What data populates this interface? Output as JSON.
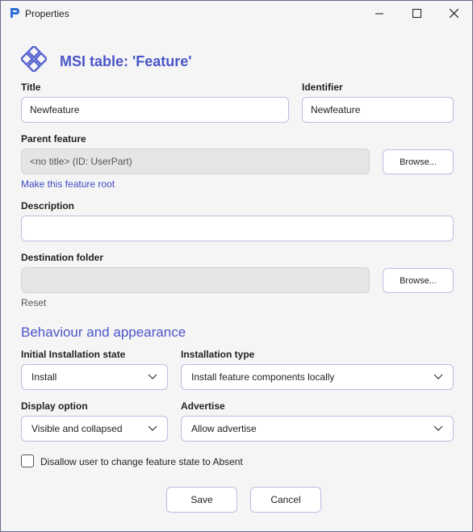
{
  "window": {
    "title": "Properties",
    "icon": "app-logo-icon",
    "controls": [
      "minimize-icon",
      "maximize-icon",
      "close-icon"
    ]
  },
  "header": {
    "icon": "feature-diamond-icon",
    "title": "MSI table: 'Feature'"
  },
  "fields": {
    "title_label": "Title",
    "title_value": "Newfeature",
    "identifier_label": "Identifier",
    "identifier_value": "Newfeature",
    "parent_label": "Parent feature",
    "parent_value": "<no title>  (ID: UserPart)",
    "parent_browse": "Browse...",
    "make_root_link": "Make this feature root",
    "description_label": "Description",
    "description_value": "",
    "destination_label": "Destination folder",
    "destination_value": "",
    "destination_browse": "Browse...",
    "reset_link": "Reset"
  },
  "behaviour": {
    "section_title": "Behaviour and appearance",
    "initial_state_label": "Initial Installation state",
    "initial_state_value": "Install",
    "install_type_label": "Installation type",
    "install_type_value": "Install feature components locally",
    "display_label": "Display option",
    "display_value": "Visible and collapsed",
    "advertise_label": "Advertise",
    "advertise_value": "Allow advertise",
    "disallow_checkbox_label": "Disallow user to change feature state to Absent",
    "disallow_checked": false
  },
  "footer": {
    "save_label": "Save",
    "cancel_label": "Cancel"
  },
  "colors": {
    "accent": "#4a55c8",
    "link": "#3c4bc2",
    "border": "#b9bfe0"
  }
}
